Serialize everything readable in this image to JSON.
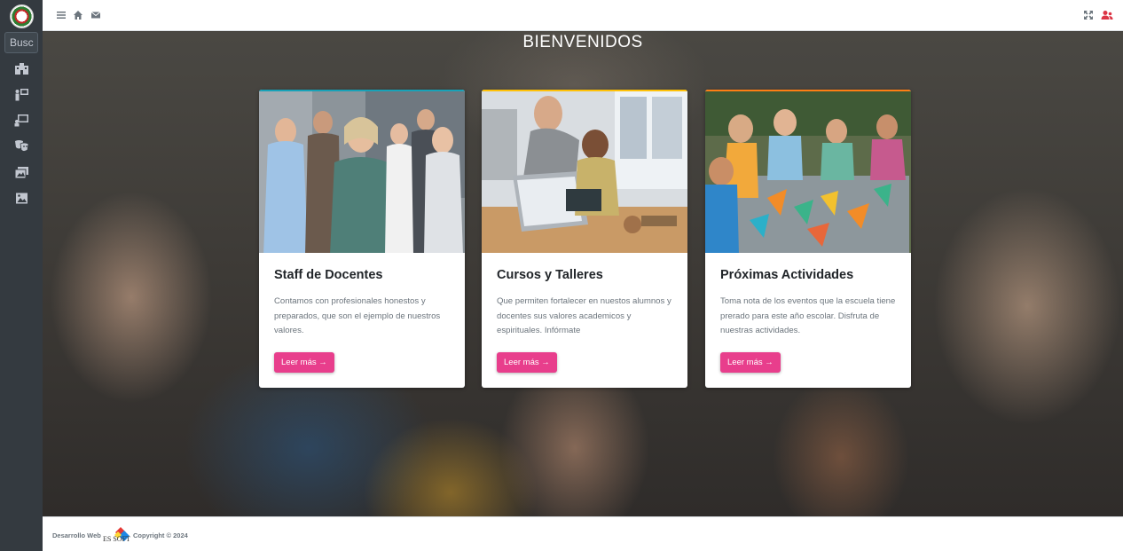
{
  "sidebar": {
    "search_placeholder": "Busc",
    "items": [
      {
        "icon": "building-icon"
      },
      {
        "icon": "teacher-board-icon"
      },
      {
        "icon": "chalkboard-user-icon"
      },
      {
        "icon": "theater-masks-icon"
      },
      {
        "icon": "photo-gallery-icon"
      },
      {
        "icon": "image-icon"
      }
    ]
  },
  "topbar": {
    "left_icons": [
      "menu-icon",
      "home-icon",
      "envelope-icon"
    ],
    "right_icons": [
      "fullscreen-icon",
      "user-group-icon"
    ]
  },
  "hero": {
    "title": "BIENVENIDOS"
  },
  "cards": [
    {
      "title": "Staff de Docentes",
      "text": "Contamos con profesionales honestos y preparados, que son el ejemplo de nuestros valores.",
      "button": "Leer más →",
      "accent": "#17a2b8"
    },
    {
      "title": "Cursos y Talleres",
      "text": "Que permiten fortalecer en nuestos alumnos y docentes sus valores academicos y espirituales. Infórmate",
      "button": "Leer más →",
      "accent": "#ffc107"
    },
    {
      "title": "Próximas Actividades",
      "text": "Toma nota de los eventos que la escuela tiene prerado para este año escolar. Disfruta de nuestras actividades.",
      "button": "Leer más →",
      "accent": "#fd7e14"
    }
  ],
  "footer": {
    "left_text": "Desarrollo Web",
    "logo_text": "ES SOFT",
    "copyright": "Copyright © 2024"
  },
  "colors": {
    "sidebar_bg": "#343a40",
    "button_pink": "#e83e8c",
    "user_icon_red": "#dc3545"
  }
}
